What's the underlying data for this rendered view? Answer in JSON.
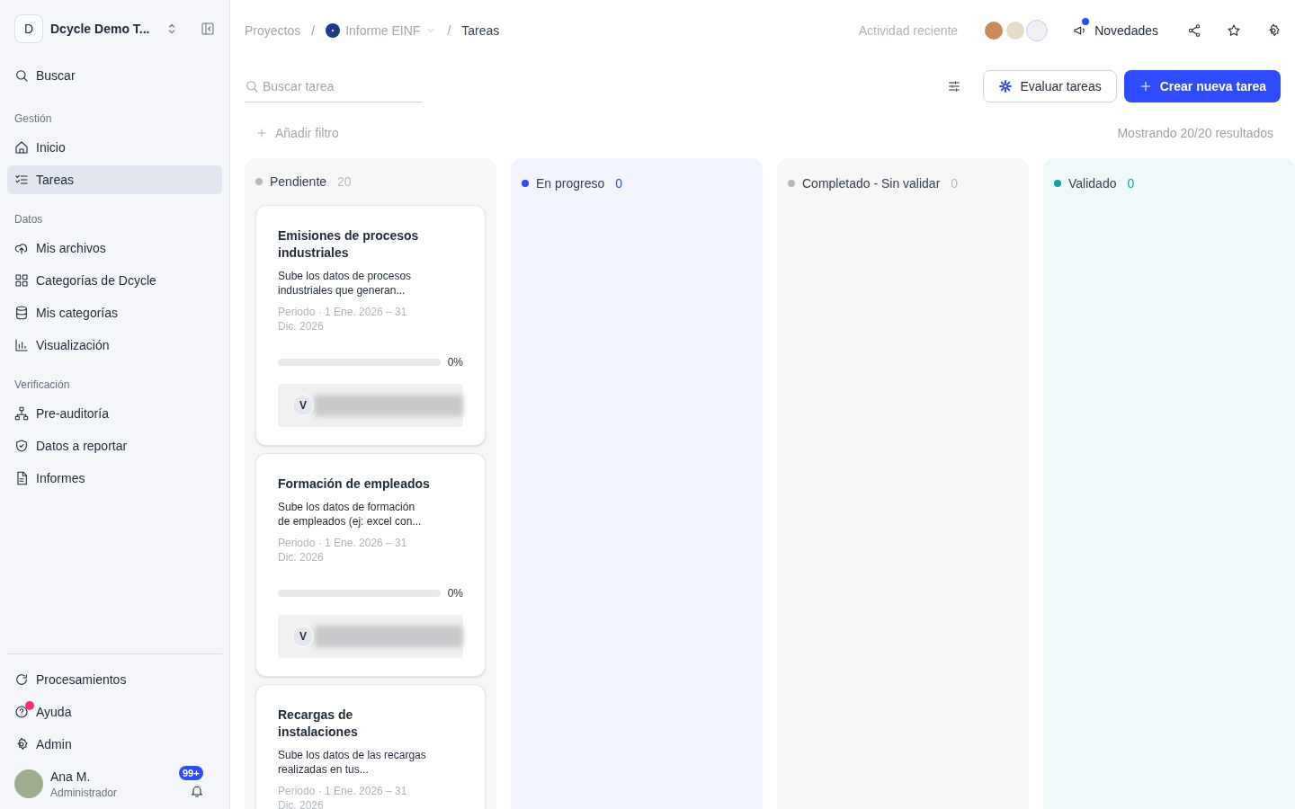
{
  "workspace": {
    "initial": "D",
    "name": "Dcycle Demo T..."
  },
  "search_item": {
    "label": "Buscar"
  },
  "sidebar_sections": [
    {
      "title": "Gestión",
      "items": [
        {
          "label": "Inicio",
          "selected": false
        },
        {
          "label": "Tareas",
          "selected": true
        }
      ]
    },
    {
      "title": "Datos",
      "items": [
        {
          "label": "Mis archivos",
          "selected": false
        },
        {
          "label": "Categorías de Dcycle",
          "selected": false
        },
        {
          "label": "Mis categorías",
          "selected": false
        },
        {
          "label": "Visualización",
          "selected": false
        }
      ]
    },
    {
      "title": "Verificación",
      "items": [
        {
          "label": "Pre-auditoría",
          "selected": false
        },
        {
          "label": "Datos a reportar",
          "selected": false
        },
        {
          "label": "Informes",
          "selected": false
        }
      ]
    }
  ],
  "sidebar_bottom": [
    {
      "label": "Procesamientos",
      "notification": false
    },
    {
      "label": "Ayuda",
      "notification": true
    },
    {
      "label": "Admin",
      "notification": false
    }
  ],
  "user": {
    "name": "Ana M.",
    "role": "Administrador",
    "notifications": "99+"
  },
  "breadcrumb": [
    {
      "label": "Proyectos",
      "current": false
    },
    {
      "separator": "/",
      "label": "Informe EINF",
      "current": false
    },
    {
      "separator": "/",
      "label": "Tareas",
      "current": true
    }
  ],
  "header": {
    "recent_activity": "Actividad reciente",
    "news": "Novedades"
  },
  "search": {
    "placeholder": "Buscar tarea"
  },
  "buttons": {
    "evaluate": "Evaluar tareas",
    "create": "Crear nueva tarea"
  },
  "add_filter": "Añadir filtro",
  "results": "Mostrando 20/20 resultados",
  "columns": [
    {
      "title": "Pendiente",
      "count": "20",
      "color": "#b5b8bf",
      "cards": [
        {
          "title": "Emisiones de procesos industriales",
          "description": "Sube los datos de procesos industriales que generan...",
          "period": "Periodo · 1 Ene. 2026 – 31 Dic. 2026",
          "level": 0,
          "percent": "0%",
          "assignee": "V"
        },
        {
          "title": "Formación de empleados",
          "description": "Sube los datos de formación de empleados (ej: excel con...",
          "period": "Periodo · 1 Ene. 2026 – 31 Dic. 2026",
          "level": 0,
          "percent": "0%",
          "assignee": "V"
        },
        {
          "title": "Recargas de instalaciones",
          "description": "Sube los datos de las recargas realizadas en tus...",
          "period": "Periodo · 1 Ene. 2026 – 31 Dic. 2026"
        }
      ]
    },
    {
      "title": "En progreso",
      "count": "0",
      "color": "#2e4bff"
    },
    {
      "title": "Completado - Sin validar",
      "count": "0",
      "color": "#b5b8bf"
    },
    {
      "title": "Validado",
      "count": "0",
      "color": "#13a3a3"
    }
  ]
}
